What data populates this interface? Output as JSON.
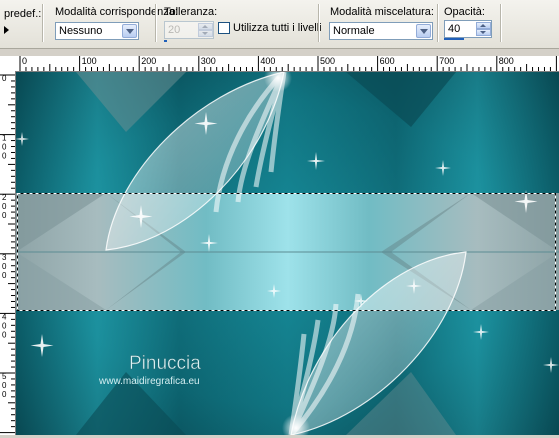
{
  "toolbar": {
    "preset_label": "predef.:",
    "match_mode": {
      "label": "Modalità corrispondenza:",
      "value": "Nessuno"
    },
    "tolerance": {
      "label": "Tolleranza:",
      "value": "20"
    },
    "use_all_layers": {
      "label": "Utilizza tutti i livelli",
      "checked": false
    },
    "blend_mode": {
      "label": "Modalità miscelatura:",
      "value": "Normale"
    },
    "opacity": {
      "label": "Opacità:",
      "value": "40"
    }
  },
  "ruler": {
    "horizontal_ticks": [
      "0",
      "100",
      "200",
      "300",
      "400",
      "500",
      "600",
      "700",
      "800"
    ],
    "vertical_ticks": [
      "0",
      "1 0 0",
      "2 0 0",
      "3 0 0",
      "4 0 0",
      "5 0 0"
    ]
  },
  "canvas": {
    "watermark_name": "Pinuccia",
    "watermark_url": "www.maidiregrafica.eu",
    "colors": {
      "teal_dark": "#0a4b55",
      "teal": "#1a97a6",
      "teal_light": "#6fd0da",
      "gray_band": "#8fa6a9"
    }
  }
}
